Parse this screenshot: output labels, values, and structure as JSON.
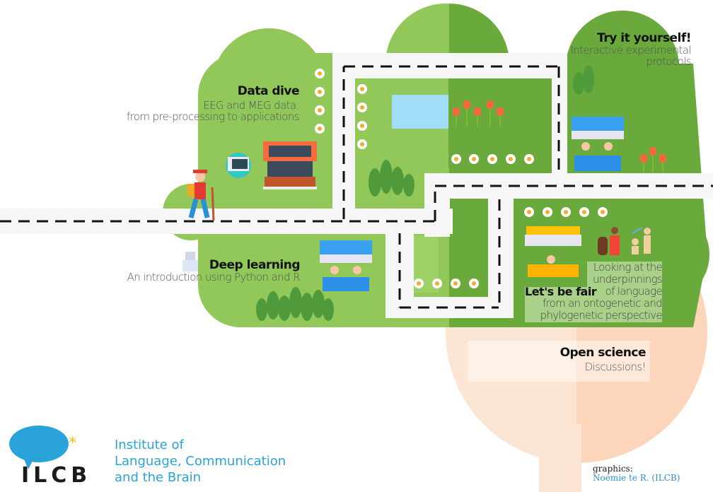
{
  "colors": {
    "canopy_light": "#92c85a",
    "canopy_dark": "#6aaa3c",
    "road": "#f6f6f6",
    "road_dash": "#111111",
    "trunk_light": "#fde5d4",
    "trunk_dark": "#fdd5bb",
    "pond": "#a3def8",
    "logo_blue": "#2aa3d8",
    "logo_star": "#f4c20d"
  },
  "stations": {
    "data_dive": {
      "title": "Data dive",
      "lines": [
        "EEG and MEG data:",
        "from pre-processing to applications"
      ]
    },
    "try_it": {
      "title": "Try it yourself!",
      "lines": [
        "Interactive experimental",
        "protocols"
      ]
    },
    "deep_learning": {
      "title": "Deep learning",
      "lines": [
        "An introduction using Python and R"
      ]
    },
    "lets_be_fair": {
      "title": "Let's be fair",
      "lines": [
        "Looking at the",
        "underpinnings",
        "of  language",
        "from an ontogenetic and",
        "phylogenetic perspective"
      ]
    },
    "open_science": {
      "title": "Open science",
      "lines": [
        "Discussions!"
      ]
    }
  },
  "logo": {
    "acronym": "ILCB",
    "lines": [
      "Institute of",
      "Language, Communication",
      "and the Brain"
    ]
  },
  "credit": {
    "label": "graphics:",
    "author": "Noémie te R. (ILCB)"
  }
}
